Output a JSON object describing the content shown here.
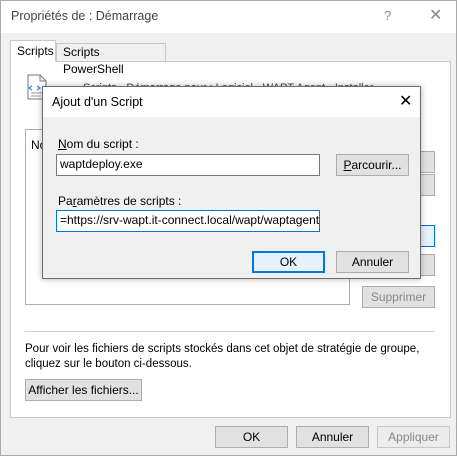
{
  "outer_window": {
    "title": "Propriétés de : Démarrage",
    "help_glyph": "?",
    "close_glyph": "✕",
    "tabs": [
      {
        "label": "Scripts"
      },
      {
        "label": "Scripts PowerShell"
      }
    ],
    "obscured_heading": "Scripts - Démarrage  pour : Logiciel - WAPT Agent - Installer",
    "list_header": "No",
    "remove_label": "Supprimer",
    "info_text": "Pour voir les fichiers de scripts stockés dans cet objet de stratégie de groupe, cliquez sur le bouton ci-dessous.",
    "show_files_label": "Afficher les fichiers...",
    "ok_label": "OK",
    "cancel_label": "Annuler",
    "apply_label": "Appliquer"
  },
  "dialog": {
    "title": "Ajout d'un Script",
    "close_glyph": "✕",
    "name_label_hotkey": "N",
    "name_label_rest": "om du script :",
    "name_value": "waptdeploy.exe",
    "browse_hotkey": "P",
    "browse_rest": "arcourir...",
    "params_label_pre": "Pa",
    "params_label_hotkey": "r",
    "params_label_rest": "amètres de scripts :",
    "params_value": "=https://srv-wapt.it-connect.local/wapt/waptagent.exe",
    "ok_label": "OK",
    "cancel_label": "Annuler"
  },
  "colors": {
    "accent": "#0078d7",
    "window_bg": "#f0f0f0"
  }
}
